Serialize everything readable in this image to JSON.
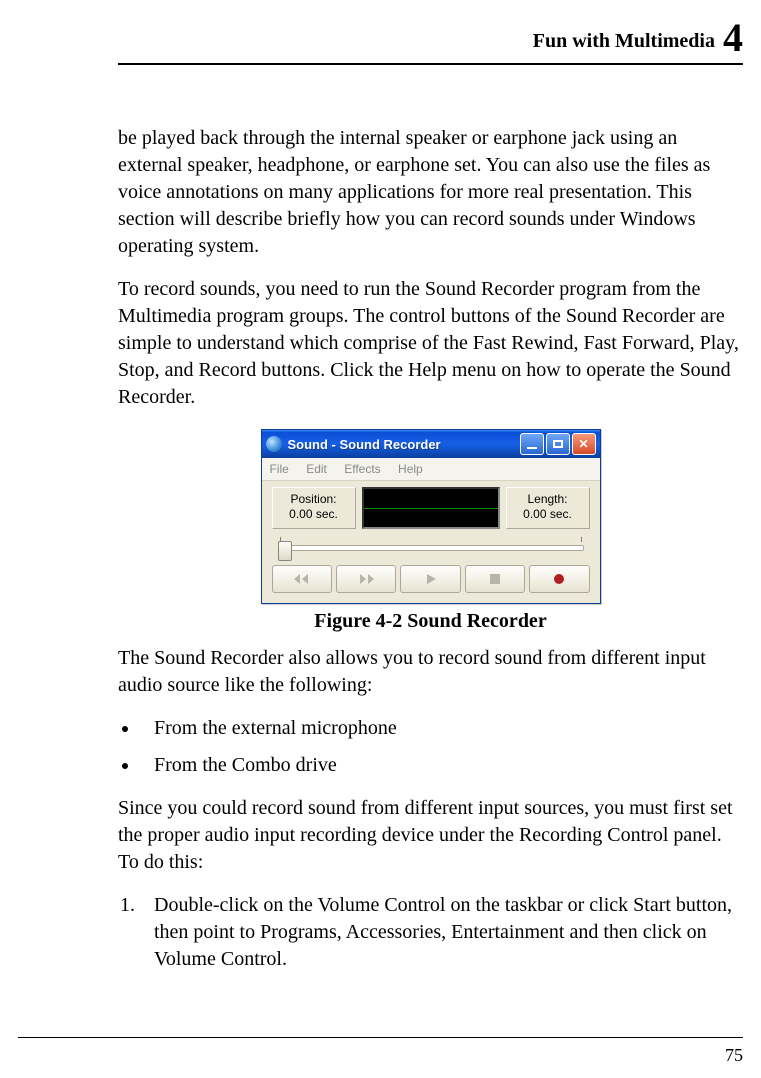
{
  "header": {
    "title": "Fun with Multimedia",
    "chapter": "4"
  },
  "paragraphs": {
    "p1": "be played back through the internal speaker or earphone jack using an external speaker, headphone, or earphone set. You can also use the files as voice annotations on many applications for more real presentation. This section will describe briefly how you can record sounds under Windows operating system.",
    "p2": "To record sounds, you need to run the Sound Recorder program from the Multimedia program groups. The control buttons of the Sound Recorder are simple to understand which comprise of the Fast Rewind, Fast Forward, Play, Stop, and Record buttons. Click the Help menu on how to operate the Sound Recorder.",
    "p3": "The Sound Recorder also allows you to record sound from different input audio source like the following:",
    "p4": "Since you could record sound from different input sources, you must first set the proper audio input recording device under the Recording Control panel. To do this:"
  },
  "bullets": [
    "From the external microphone",
    "From the Combo drive"
  ],
  "steps": [
    "Double-click on the Volume Control on the taskbar or click Start button, then point to Programs, Accessories, Entertainment and then click on Volume Control."
  ],
  "figure": {
    "caption": "Figure 4-2    Sound Recorder",
    "window_title": "Sound - Sound Recorder",
    "menus": {
      "file": "File",
      "edit": "Edit",
      "effects": "Effects",
      "help": "Help"
    },
    "position_label": "Position:",
    "position_value": "0.00 sec.",
    "length_label": "Length:",
    "length_value": "0.00 sec."
  },
  "page_number": "75"
}
